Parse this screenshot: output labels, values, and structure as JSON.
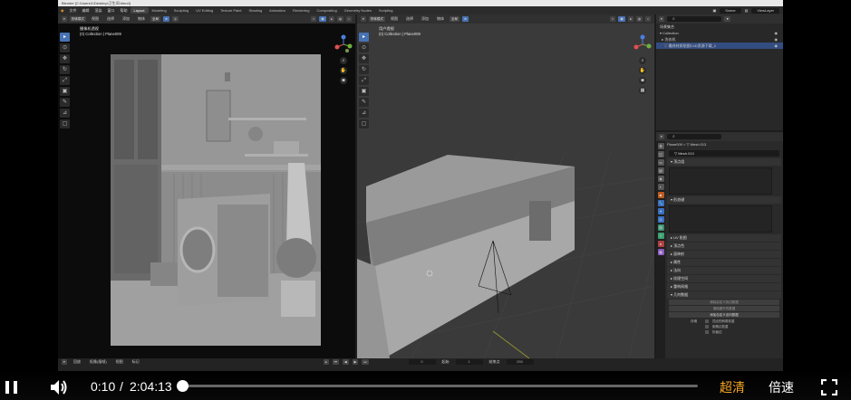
{
  "blender": {
    "title_bar": "Blender [C:\\Users\\1\\Desktop\\卫生间.blend]",
    "menus": [
      "文件",
      "编辑",
      "渲染",
      "窗口",
      "帮助"
    ],
    "workspace_tabs": [
      "Layout",
      "Modeling",
      "Sculpting",
      "UV Editing",
      "Texture Paint",
      "Shading",
      "Animation",
      "Rendering",
      "Compositing",
      "Geometry Nodes",
      "Scripting"
    ],
    "active_workspace": "Layout",
    "scene": "Scene",
    "view_layer": "ViewLayer",
    "left_viewport": {
      "mode": "物体模式",
      "menus": [
        "视图",
        "选择",
        "添加",
        "物体"
      ],
      "transform": "全局",
      "info_line1": "摄像机透视",
      "info_line2": "(0) Collection | Plane009",
      "options_label": "选项"
    },
    "right_viewport": {
      "mode": "物体模式",
      "menus": [
        "视图",
        "选择",
        "添加",
        "物体"
      ],
      "transform": "全局",
      "info_line1": "用户透视",
      "info_line2": "(0) Collection | Plane009",
      "options_label": "选项"
    },
    "outliner": {
      "rows": [
        {
          "label": "场景集合",
          "selected": false
        },
        {
          "label": "Collection",
          "selected": false
        },
        {
          "label": "洗衣机",
          "selected": false
        },
        {
          "label": "最终材质贴图C4D资源下载_2",
          "selected": true
        }
      ]
    },
    "properties": {
      "breadcrumb_object": "Plane009",
      "breadcrumb_mesh": "Mesh.013",
      "mesh_name": "Mesh.013",
      "panels": [
        "顶点组",
        "形态键",
        "UV 贴图",
        "顶点色",
        "面映射",
        "属性",
        "法向",
        "纹理空间",
        "重构网格",
        "几何数据"
      ],
      "geometry_buttons": [
        "清除自定义拆边数据",
        "清除额外的数据",
        "添加自定义法向数据"
      ],
      "store_label": "存储",
      "checkboxes": [
        "顶点的斜角权重",
        "倒角边权重",
        "折痕边"
      ]
    },
    "timeline": {
      "menus": [
        "回放",
        "抠像(插帧)",
        "视图",
        "标记"
      ],
      "current_frame": "0",
      "start_label": "起始",
      "start_frame": "1",
      "end_label": "结束点",
      "end_frame": "250"
    }
  },
  "player": {
    "current_time": "0:10",
    "separator": "/",
    "total_time": "2:04:13",
    "progress": 0.0013,
    "quality_label": "超清",
    "speed_label": "倍速",
    "quality_color": "#f5a623"
  },
  "icons": [
    "pause-icon",
    "volume-icon",
    "fullscreen-icon"
  ]
}
